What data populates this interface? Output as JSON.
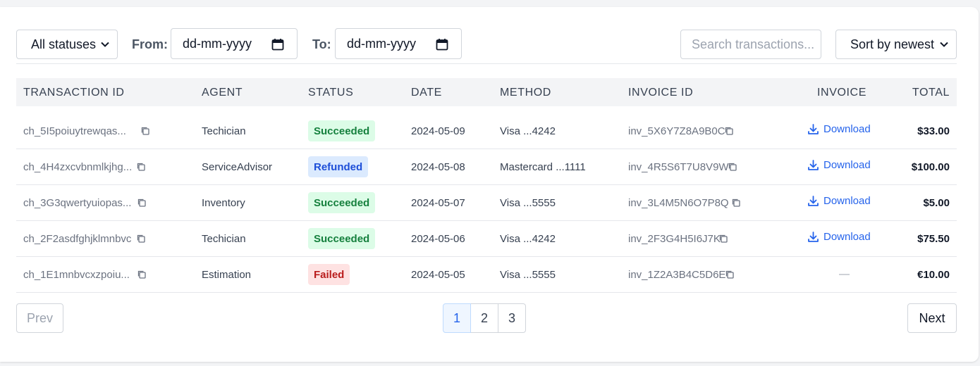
{
  "filters": {
    "status_value": "All statuses",
    "from_label": "From:",
    "from_value": "dd-mm-yyyy",
    "to_label": "To:",
    "to_value": "dd-mm-yyyy",
    "search_placeholder": "Search transactions...",
    "sort_value": "Sort by newest"
  },
  "table": {
    "headers": [
      "TRANSACTION ID",
      "AGENT",
      "STATUS",
      "DATE",
      "METHOD",
      "INVOICE ID",
      "INVOICE",
      "TOTAL"
    ],
    "download_label": "Download",
    "empty_invoice": "—",
    "rows": [
      {
        "txn": "ch_5I5poiuytrewqas...",
        "agent": "Techician",
        "status": "Succeeded",
        "date": "2024-05-09",
        "method": "Visa ...4242",
        "invoice_id": "inv_5X6Y7Z8A9B0C",
        "has_invoice": true,
        "total": "$33.00"
      },
      {
        "txn": "ch_4H4zxcvbnmlkjhg...",
        "agent": "ServiceAdvisor",
        "status": "Refunded",
        "date": "2024-05-08",
        "method": "Mastercard ...1111",
        "invoice_id": "inv_4R5S6T7U8V9W",
        "has_invoice": true,
        "total": "$100.00"
      },
      {
        "txn": "ch_3G3qwertyuiopas...",
        "agent": "Inventory",
        "status": "Succeeded",
        "date": "2024-05-07",
        "method": "Visa ...5555",
        "invoice_id": "inv_3L4M5N6O7P8Q",
        "has_invoice": true,
        "total": "$5.00"
      },
      {
        "txn": "ch_2F2asdfghjklmnbvc",
        "agent": "Techician",
        "status": "Succeeded",
        "date": "2024-05-06",
        "method": "Visa ...4242",
        "invoice_id": "inv_2F3G4H5I6J7K",
        "has_invoice": true,
        "total": "$75.50"
      },
      {
        "txn": "ch_1E1mnbvcxzpoiu...",
        "agent": "Estimation",
        "status": "Failed",
        "date": "2024-05-05",
        "method": "Visa ...5555",
        "invoice_id": "inv_1Z2A3B4C5D6E",
        "has_invoice": false,
        "total": "€10.00"
      }
    ]
  },
  "status_colors": {
    "Succeeded": {
      "bg": "#dcfce7",
      "fg": "#15803d"
    },
    "Refunded": {
      "bg": "#dbeafe",
      "fg": "#1d4ed8"
    },
    "Failed": {
      "bg": "#fee2e2",
      "fg": "#b91c1c"
    }
  },
  "pagination": {
    "prev_label": "Prev",
    "next_label": "Next",
    "pages": [
      "1",
      "2",
      "3"
    ],
    "current": "1"
  },
  "icons": {
    "copy": "copy-icon",
    "download": "download-icon",
    "calendar": "calendar-icon",
    "chevron": "chevron-down-icon"
  }
}
